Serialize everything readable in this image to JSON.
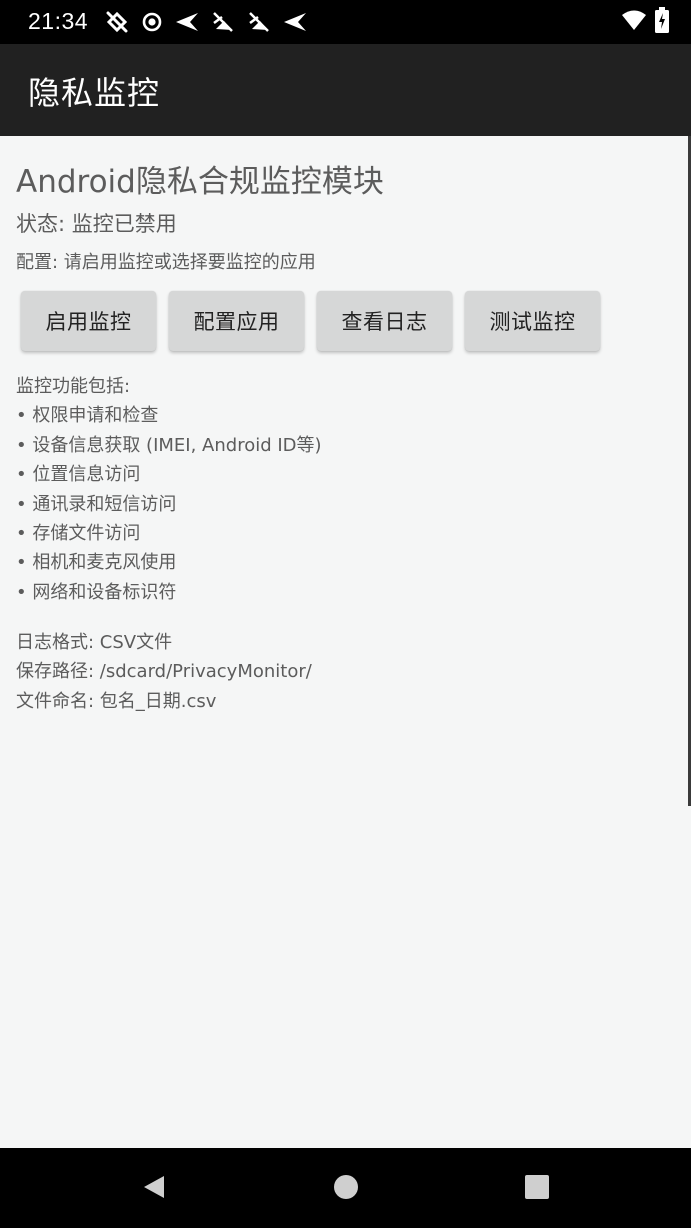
{
  "status_bar": {
    "time": "21:34"
  },
  "app_bar": {
    "title": "隐私监控"
  },
  "main": {
    "title": "Android隐私合规监控模块",
    "status_text": "状态: 监控已禁用",
    "config_text": "配置: 请启用监控或选择要监控的应用",
    "buttons": [
      {
        "label": "启用监控"
      },
      {
        "label": "配置应用"
      },
      {
        "label": "查看日志"
      },
      {
        "label": "测试监控"
      }
    ],
    "features_header": "监控功能包括:",
    "features": [
      "• 权限申请和检查",
      "• 设备信息获取 (IMEI, Android ID等)",
      "• 位置信息访问",
      "• 通讯录和短信访问",
      "• 存储文件访问",
      "• 相机和麦克风使用",
      "• 网络和设备标识符"
    ],
    "log_info": [
      "日志格式: CSV文件",
      "保存路径: /sdcard/PrivacyMonitor/",
      "文件命名: 包名_日期.csv"
    ]
  },
  "icons": {
    "status_left": [
      "cast-off-icon",
      "record-icon",
      "send-icon",
      "send-off-icon",
      "send-off-icon",
      "send-icon"
    ],
    "status_right": [
      "wifi-icon",
      "battery-icon"
    ],
    "nav": [
      "back-icon",
      "home-icon",
      "recents-icon"
    ]
  },
  "colors": {
    "app_bar": "#212121",
    "status_bar": "#000000",
    "background": "#f5f6f6",
    "button": "#d6d7d7"
  }
}
